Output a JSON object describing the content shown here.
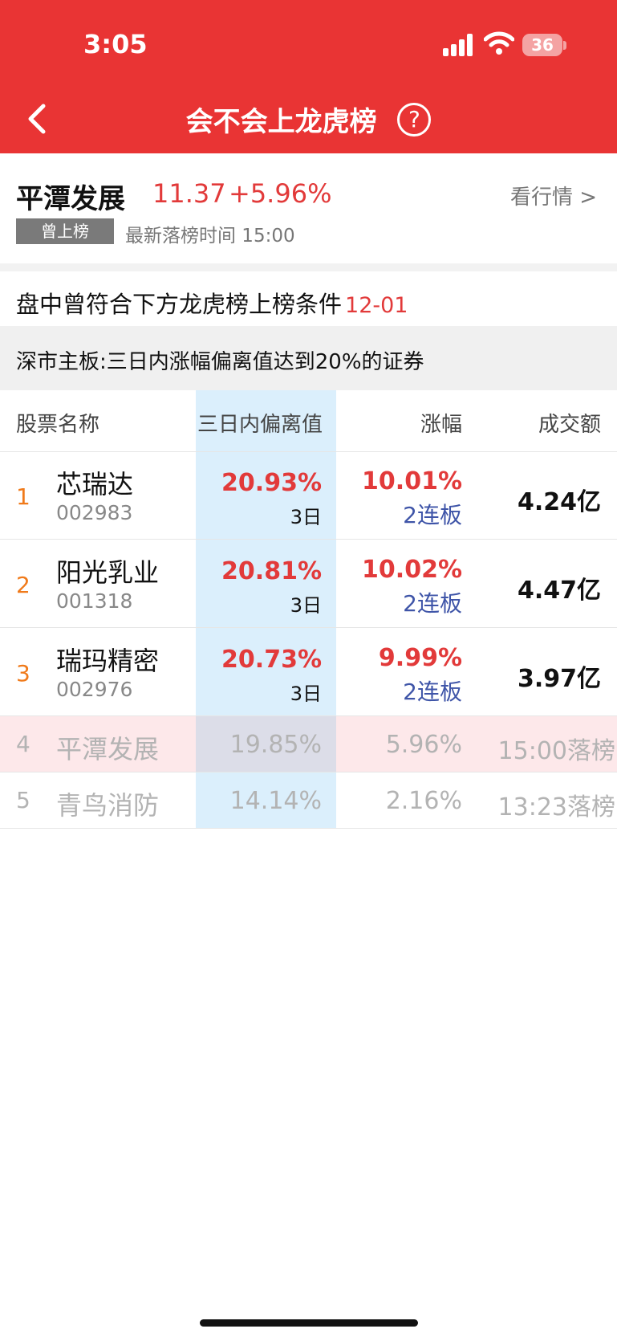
{
  "status_bar": {
    "time": "3:05",
    "battery": "36"
  },
  "header": {
    "title": "会不会上龙虎榜",
    "help_icon": "?"
  },
  "stock": {
    "name": "平潭发展",
    "price": "11.37",
    "change": "+5.96%",
    "quote_link": "看行情 >",
    "badge": "曾上榜",
    "latest_time": "最新落榜时间 15:00"
  },
  "condition": {
    "title": "盘中曾符合下方龙虎榜上榜条件",
    "date": "12-01",
    "rule": "深市主板:三日内涨幅偏离值达到20%的证券"
  },
  "table": {
    "headers": [
      "股票名称",
      "三日内偏离值",
      "涨幅",
      "成交额"
    ],
    "rows": [
      {
        "rank": "1",
        "name": "芯瑞达",
        "code": "002983",
        "deviation": "20.93%",
        "days": "3日",
        "change": "10.01%",
        "streak": "2连板",
        "amount": "4.24亿"
      },
      {
        "rank": "2",
        "name": "阳光乳业",
        "code": "001318",
        "deviation": "20.81%",
        "days": "3日",
        "change": "10.02%",
        "streak": "2连板",
        "amount": "4.47亿"
      },
      {
        "rank": "3",
        "name": "瑞玛精密",
        "code": "002976",
        "deviation": "20.73%",
        "days": "3日",
        "change": "9.99%",
        "streak": "2连板",
        "amount": "3.97亿"
      },
      {
        "rank": "4",
        "name": "平潭发展",
        "deviation": "19.85%",
        "change": "5.96%",
        "amount": "15:00落榜"
      },
      {
        "rank": "5",
        "name": "青鸟消防",
        "deviation": "14.14%",
        "change": "2.16%",
        "amount": "13:23落榜"
      }
    ]
  },
  "colors": {
    "brand_red": "#e93434",
    "up_red": "#e23a3a",
    "streak_blue": "#3f55a8",
    "highlight_col": "#dbeffc",
    "current_row": "#fde8ea"
  }
}
